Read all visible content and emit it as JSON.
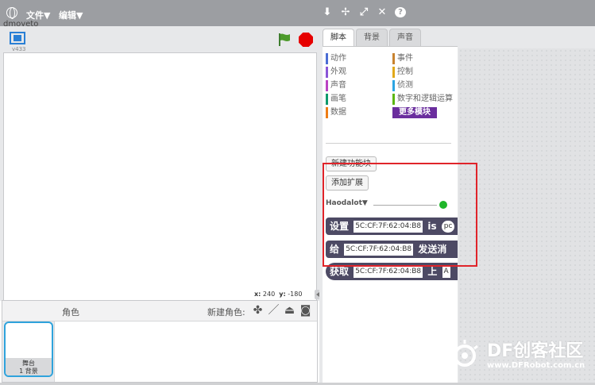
{
  "menubar": {
    "file_label": "文件▼",
    "edit_label": "编辑▼",
    "tools": [
      "duplicate-icon",
      "cut-icon",
      "grow-icon",
      "shrink-icon",
      "help-icon"
    ]
  },
  "ghost_text": "dmoyeto",
  "stage": {
    "version": "v433",
    "x_label": "x:",
    "x_value": "240",
    "y_label": "y:",
    "y_value": "-180"
  },
  "sprites": {
    "title": "角色",
    "new_sprite_label": "新建角色:",
    "stage_thumb_name": "舞台",
    "stage_thumb_sub": "1 背景"
  },
  "tabs": [
    {
      "label": "脚本",
      "active": true
    },
    {
      "label": "背景",
      "active": false
    },
    {
      "label": "声音",
      "active": false
    }
  ],
  "categories": {
    "left": [
      {
        "label": "动作",
        "color": "#4a6cd4"
      },
      {
        "label": "外观",
        "color": "#8a55d7"
      },
      {
        "label": "声音",
        "color": "#bb42c3"
      },
      {
        "label": "画笔",
        "color": "#0e9a6c"
      },
      {
        "label": "数据",
        "color": "#ee7d16"
      }
    ],
    "right": [
      {
        "label": "事件",
        "color": "#c88330"
      },
      {
        "label": "控制",
        "color": "#e1a91a"
      },
      {
        "label": "侦测",
        "color": "#2ca5e2"
      },
      {
        "label": "数字和逻辑运算",
        "color": "#5cb712"
      },
      {
        "label": "更多模块",
        "color": "#6b2e9e"
      }
    ]
  },
  "buttons": {
    "make_block": "新建功能块",
    "add_extension": "添加扩展"
  },
  "extension": {
    "name": "Haodalot▼",
    "status_color": "#1fb62a"
  },
  "blocks": [
    {
      "prefix": "设置",
      "mac": "5C:CF:7F:62:04:B8",
      "suffix": "is",
      "tail": "pc"
    },
    {
      "prefix": "给",
      "mac": "5C:CF:7F:62:04:B8",
      "suffix": "发送消"
    },
    {
      "prefix": "获取",
      "mac": "5C:CF:7F:62:04:B8",
      "suffix": "上",
      "tail": "A"
    }
  ],
  "watermark": {
    "brand": "DF创客社区",
    "url": "www.DFRobot.com.cn"
  },
  "colors": {
    "menubar": "#9c9ea2",
    "accent": "#2a7fd5",
    "highlight": "#e0242a",
    "block": "#4d4a64"
  }
}
